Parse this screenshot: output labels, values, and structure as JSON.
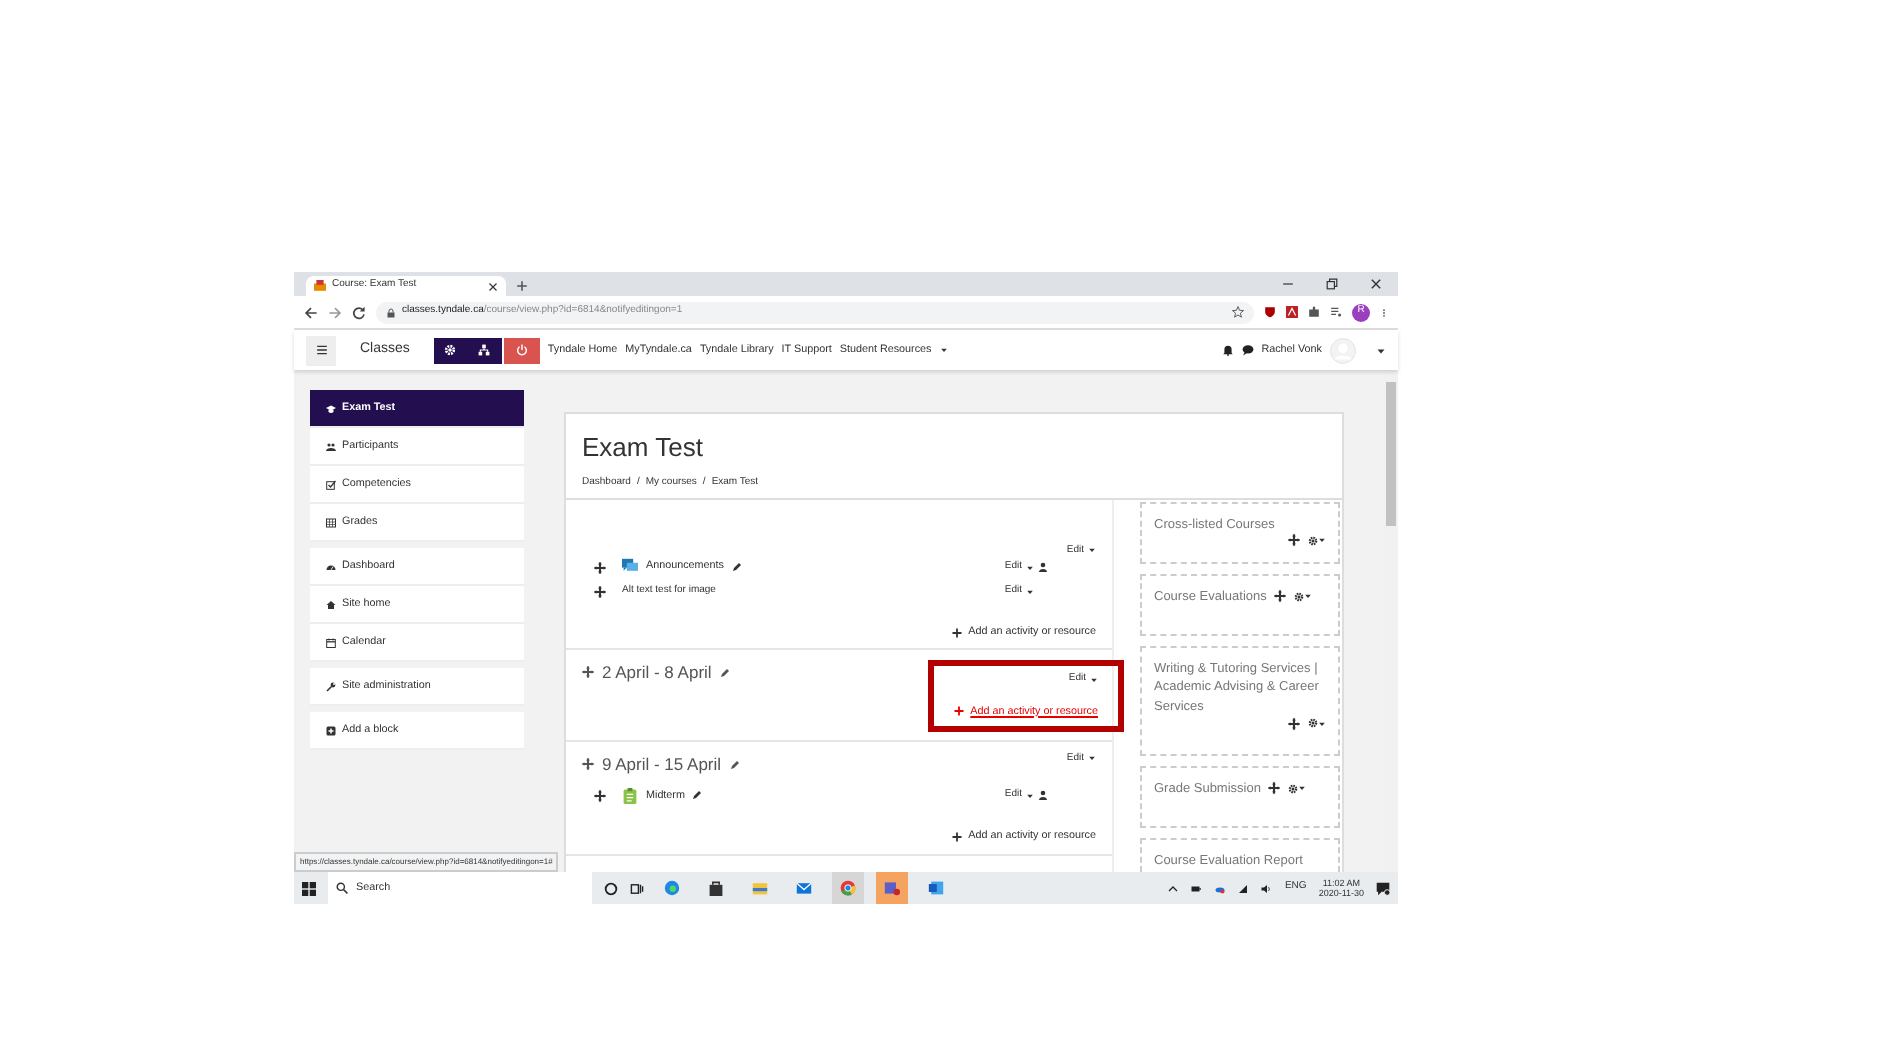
{
  "browser": {
    "tab_title": "Course: Exam Test",
    "url_host": "classes.tyndale.ca",
    "url_path": "/course/view.php?id=6814&notifyeditingon=1",
    "profile_initial": "R",
    "status_url": "https://classes.tyndale.ca/course/view.php?id=6814&notifyeditingon=1#"
  },
  "navbar": {
    "brand": "Classes",
    "links": [
      {
        "label": "Tyndale Home",
        "dropdown": false
      },
      {
        "label": "MyTyndale.ca",
        "dropdown": false
      },
      {
        "label": "Tyndale Library",
        "dropdown": false
      },
      {
        "label": "IT Support",
        "dropdown": false
      },
      {
        "label": "Student Resources",
        "dropdown": true
      }
    ],
    "user": "Rachel Vonk"
  },
  "sidebar": {
    "groups": [
      [
        {
          "label": "Exam Test",
          "kind": "course",
          "selected": true
        },
        {
          "label": "Participants",
          "kind": "users",
          "selected": false
        },
        {
          "label": "Competencies",
          "kind": "check",
          "selected": false
        },
        {
          "label": "Grades",
          "kind": "table",
          "selected": false
        }
      ],
      [
        {
          "label": "Dashboard",
          "kind": "dashboard",
          "selected": false
        },
        {
          "label": "Site home",
          "kind": "home",
          "selected": false
        },
        {
          "label": "Calendar",
          "kind": "calendar",
          "selected": false
        }
      ],
      [
        {
          "label": "Site administration",
          "kind": "wrench",
          "selected": false
        }
      ],
      [
        {
          "label": "Add a block",
          "kind": "plus",
          "selected": false
        }
      ]
    ]
  },
  "page": {
    "title": "Exam Test",
    "breadcrumb": [
      "Dashboard",
      "My courses",
      "Exam Test"
    ],
    "breadcrumb_separator": "/",
    "sections": [
      {
        "edit": "Edit",
        "highlighted": false,
        "add": "Add an activity or resource",
        "activities": [
          {
            "name": "Announcements",
            "kind": "forum",
            "edit": "Edit"
          },
          {
            "name": "Alt text test for image",
            "kind": "label",
            "edit": "Edit"
          }
        ]
      },
      {
        "title": "2 April - 8 April",
        "edit": "Edit",
        "highlighted": true,
        "add": "Add an activity or resource"
      },
      {
        "title": "9 April - 15 April",
        "edit": "Edit",
        "highlighted": false,
        "add": "Add an activity or resource",
        "activities": [
          {
            "name": "Midterm",
            "kind": "assign",
            "edit": "Edit"
          }
        ]
      }
    ],
    "blocks": [
      {
        "title": "Cross-listed Courses"
      },
      {
        "title": "Course Evaluations"
      },
      {
        "title": "Writing & Tutoring Services | Academic Advising & Career Services"
      },
      {
        "title": "Grade Submission"
      },
      {
        "title": "Course Evaluation Report"
      }
    ]
  },
  "taskbar": {
    "search": "Search",
    "language": "ENG",
    "time": "11:02 AM",
    "date": "2020-11-30"
  }
}
